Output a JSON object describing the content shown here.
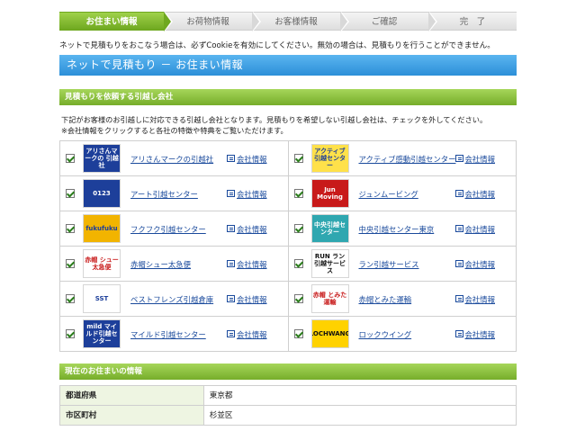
{
  "steps": [
    {
      "label": "お住まい情報",
      "active": true
    },
    {
      "label": "お荷物情報",
      "active": false
    },
    {
      "label": "お客様情報",
      "active": false
    },
    {
      "label": "ご確認",
      "active": false
    },
    {
      "label": "完　了",
      "active": false
    }
  ],
  "notice": "ネットで見積もりをおこなう場合は、必ずCookieを有効にしてください。無効の場合は、見積もりを行うことができません。",
  "main_title": "ネットで見積もり － お住まい情報",
  "companies_section": {
    "title": "見積もりを依頼する引越し会社",
    "desc_line1": "下記がお客様のお引越しに対応できる引越し会社となります。見積もりを希望しない引越し会社は、チェックを外してください。",
    "desc_line2": "※会社情報をクリックすると各社の特徴や特典をご覧いただけます。",
    "info_label": "会社情報",
    "companies": [
      {
        "name": "アリさんマークの引越社",
        "logo": "アリさんマークの 引越社",
        "logo_bg": "#1d3f9a",
        "logo_fg": "#ffffff"
      },
      {
        "name": "アクティブ感動引越センター",
        "logo": "アクティブ 引越センター",
        "logo_bg": "#ffe14a",
        "logo_fg": "#1d3f9a"
      },
      {
        "name": "アート引越センター",
        "logo": "0123",
        "logo_bg": "#1d3f9a",
        "logo_fg": "#ffffff"
      },
      {
        "name": "ジュンムービング",
        "logo": "Jun Moving",
        "logo_bg": "#c81a1a",
        "logo_fg": "#ffffff"
      },
      {
        "name": "フクフク引越センター",
        "logo": "fukufuku",
        "logo_bg": "#f2b400",
        "logo_fg": "#1d3f9a"
      },
      {
        "name": "中央引越センター東京",
        "logo": "中央引越センター",
        "logo_bg": "#2fa7b0",
        "logo_fg": "#ffffff"
      },
      {
        "name": "赤帽シュー太急便",
        "logo": "赤帽 シュー太急便",
        "logo_bg": "#ffffff",
        "logo_fg": "#c81a1a"
      },
      {
        "name": "ラン引越サービス",
        "logo": "RUN ラン引越サービス",
        "logo_bg": "#ffffff",
        "logo_fg": "#111111"
      },
      {
        "name": "ベストフレンズ引越倉庫",
        "logo": "SST",
        "logo_bg": "#ffffff",
        "logo_fg": "#1d3f9a"
      },
      {
        "name": "赤帽とみた運輸",
        "logo": "赤帽 とみた運輸",
        "logo_bg": "#ffffff",
        "logo_fg": "#c81a1a"
      },
      {
        "name": "マイルド引越センター",
        "logo": "mild マイルド引越センター",
        "logo_bg": "#1d3f9a",
        "logo_fg": "#ffffff"
      },
      {
        "name": "ロックウイング",
        "logo": "LOCHWANG",
        "logo_bg": "#ffd200",
        "logo_fg": "#111111"
      }
    ]
  },
  "residence_section": {
    "title": "現在のお住まいの情報",
    "rows": [
      {
        "label": "都道府県",
        "value": "東京都"
      },
      {
        "label": "市区町村",
        "value": "杉並区"
      }
    ]
  },
  "colors": {
    "step_active": "#6fa820",
    "main_title_bg": "#2c8fd8",
    "section_bg": "#76ad2a",
    "link": "#1a4a9c"
  }
}
